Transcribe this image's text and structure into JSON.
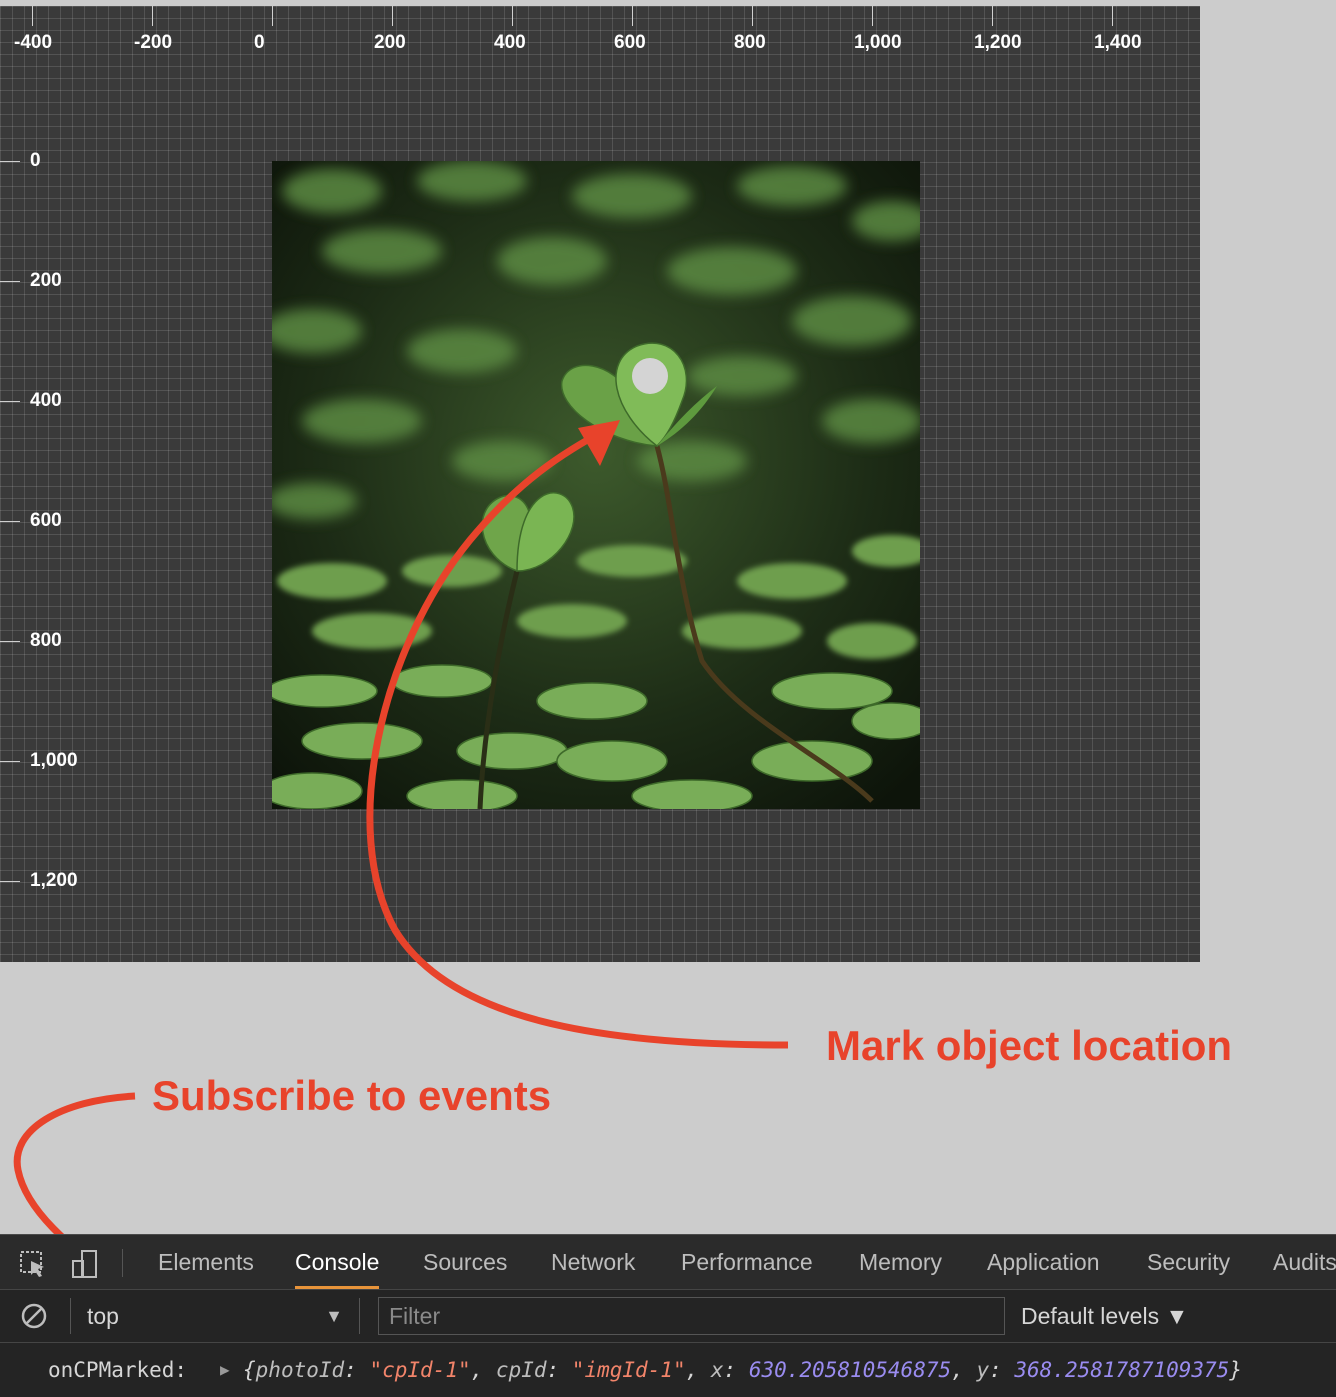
{
  "canvas": {
    "x_ticks": [
      "-400",
      "-200",
      "0",
      "200",
      "400",
      "600",
      "800",
      "1,000",
      "1,200",
      "1,400"
    ],
    "y_ticks": [
      "0",
      "200",
      "400",
      "600",
      "800",
      "1,000",
      "1,200"
    ]
  },
  "annotations": {
    "mark": "Mark object location",
    "subscribe": "Subscribe to events"
  },
  "colors": {
    "annotation": "#e8432b",
    "active_tab": "#e8943a",
    "string": "#f2846a",
    "number": "#9a8cf0"
  },
  "devtools": {
    "icons": [
      "inspect-element-icon",
      "device-toolbar-icon",
      "clear-console-icon"
    ],
    "tabs": [
      "Elements",
      "Console",
      "Sources",
      "Network",
      "Performance",
      "Memory",
      "Application",
      "Security",
      "Audits"
    ],
    "active_tab": "Console",
    "context": "top",
    "filter_placeholder": "Filter",
    "levels": "Default levels ▼",
    "log": {
      "label": "onCPMarked:",
      "photo_key": "photoId",
      "photo_val": "\"cpId-1\"",
      "cp_key": "cpId",
      "cp_val": "\"imgId-1\"",
      "x_key": "x",
      "x_val": "630.205810546875",
      "y_key": "y",
      "y_val": "368.2581787109375"
    }
  }
}
